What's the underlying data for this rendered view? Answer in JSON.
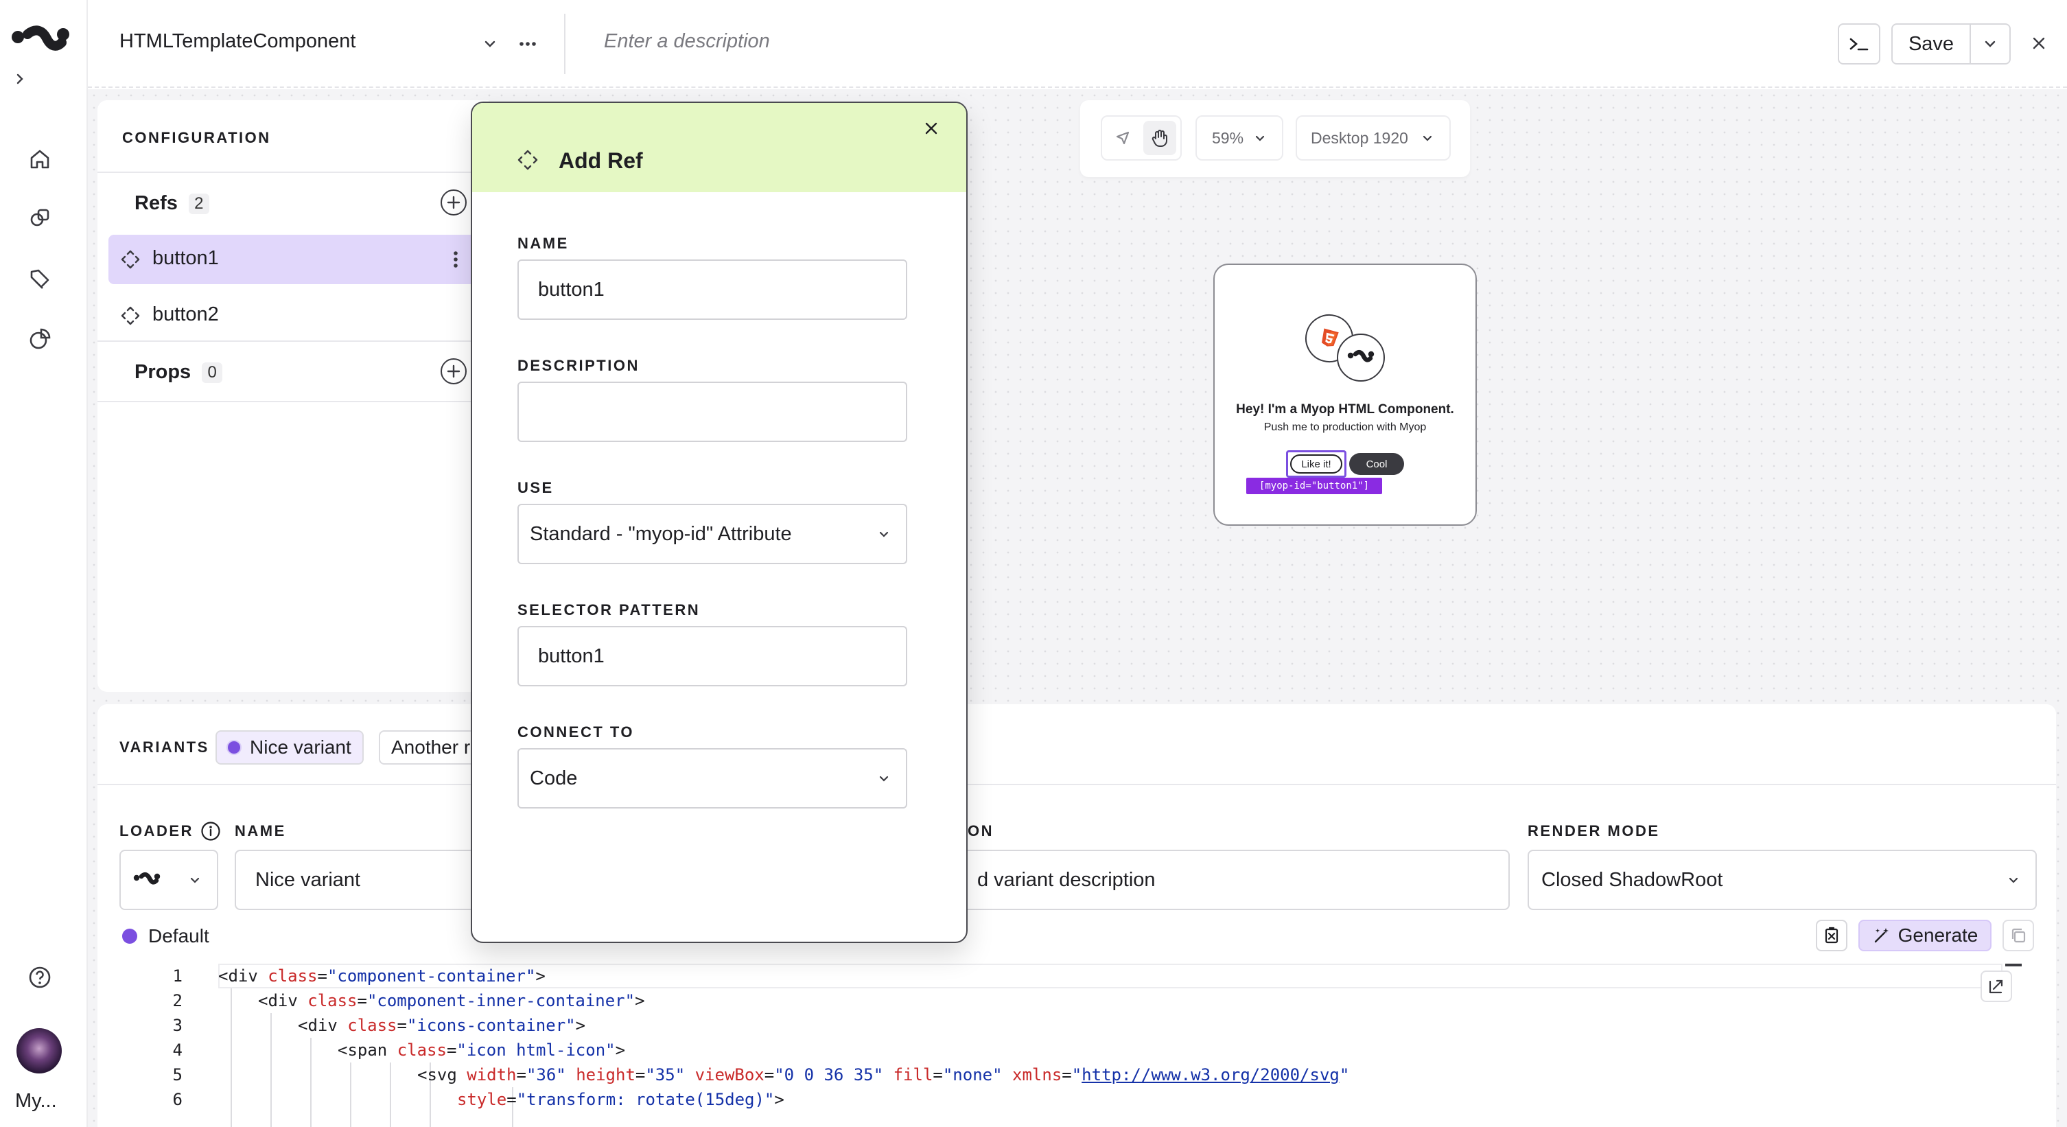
{
  "app": {
    "component_name": "HTMLTemplateComponent",
    "description_placeholder": "Enter a description",
    "save_label": "Save",
    "user_short": "My..."
  },
  "config": {
    "title": "CONFIGURATION",
    "refs": {
      "label": "Refs",
      "count": "2",
      "items": [
        {
          "label": "button1",
          "selected": true
        },
        {
          "label": "button2",
          "selected": false
        }
      ]
    },
    "props": {
      "label": "Props",
      "count": "0"
    }
  },
  "preview_toolbar": {
    "zoom": "59%",
    "device": "Desktop 1920"
  },
  "preview": {
    "title": "Hey! I'm a Myop HTML Component.",
    "subtitle": "Push me to production with Myop",
    "button_like": "Like it!",
    "button_cool": "Cool",
    "ref_tag": "[myop-id=\"button1\"]"
  },
  "variants": {
    "label": "VARIANTS",
    "tabs": [
      {
        "label": "Nice variant",
        "active": true
      },
      {
        "label": "Another r",
        "active": false
      }
    ],
    "loader_label": "LOADER",
    "name_label": "NAME",
    "name_value": "Nice variant",
    "description_label": "ON",
    "description_value": "d variant description",
    "render_mode_label": "RENDER MODE",
    "render_mode_value": "Closed ShadowRoot",
    "default_label": "Default",
    "generate_label": "Generate"
  },
  "code": {
    "lines": [
      {
        "n": "1",
        "indent": 0,
        "parts": [
          [
            "t-tag",
            "<div "
          ],
          [
            "t-attr",
            "class"
          ],
          [
            "t-tag",
            "="
          ],
          [
            "t-str",
            "\"component-container\""
          ],
          [
            "t-tag",
            ">"
          ]
        ]
      },
      {
        "n": "2",
        "indent": 1,
        "parts": [
          [
            "t-tag",
            "<div "
          ],
          [
            "t-attr",
            "class"
          ],
          [
            "t-tag",
            "="
          ],
          [
            "t-str",
            "\"component-inner-container\""
          ],
          [
            "t-tag",
            ">"
          ]
        ]
      },
      {
        "n": "3",
        "indent": 2,
        "parts": [
          [
            "t-tag",
            "<div "
          ],
          [
            "t-attr",
            "class"
          ],
          [
            "t-tag",
            "="
          ],
          [
            "t-str",
            "\"icons-container\""
          ],
          [
            "t-tag",
            ">"
          ]
        ]
      },
      {
        "n": "4",
        "indent": 3,
        "parts": [
          [
            "t-tag",
            "<span "
          ],
          [
            "t-attr",
            "class"
          ],
          [
            "t-tag",
            "="
          ],
          [
            "t-str",
            "\"icon html-icon\""
          ],
          [
            "t-tag",
            ">"
          ]
        ]
      },
      {
        "n": "5",
        "indent": 5,
        "parts": [
          [
            "t-tag",
            "<svg "
          ],
          [
            "t-attr",
            "width"
          ],
          [
            "t-tag",
            "="
          ],
          [
            "t-str",
            "\"36\" "
          ],
          [
            "t-attr",
            "height"
          ],
          [
            "t-tag",
            "="
          ],
          [
            "t-str",
            "\"35\" "
          ],
          [
            "t-attr",
            "viewBox"
          ],
          [
            "t-tag",
            "="
          ],
          [
            "t-str",
            "\"0 0 36 35\" "
          ],
          [
            "t-attr",
            "fill"
          ],
          [
            "t-tag",
            "="
          ],
          [
            "t-str",
            "\"none\" "
          ],
          [
            "t-attr",
            "xmlns"
          ],
          [
            "t-tag",
            "="
          ],
          [
            "t-str",
            "\""
          ],
          [
            "t-url",
            "http://www.w3.org/2000/svg"
          ],
          [
            "t-str",
            "\""
          ]
        ]
      },
      {
        "n": "6",
        "indent": 6,
        "parts": [
          [
            "t-attr",
            "style"
          ],
          [
            "t-tag",
            "="
          ],
          [
            "t-str",
            "\"transform: rotate(15deg)\""
          ],
          [
            "t-tag",
            ">"
          ]
        ]
      }
    ]
  },
  "modal": {
    "title": "Add Ref",
    "name_label": "NAME",
    "name_value": "button1",
    "description_label": "DESCRIPTION",
    "description_value": "",
    "use_label": "USE",
    "use_value": "Standard - \"myop-id\" Attribute",
    "selector_label": "SELECTOR PATTERN",
    "selector_value": "button1",
    "connect_label": "CONNECT TO",
    "connect_value": "Code"
  },
  "colors": {
    "accent_purple": "#7b4fe0",
    "selected_row": "#e1d7fb",
    "modal_header": "#e5f8c4",
    "tag_purple": "#8a2be2"
  }
}
